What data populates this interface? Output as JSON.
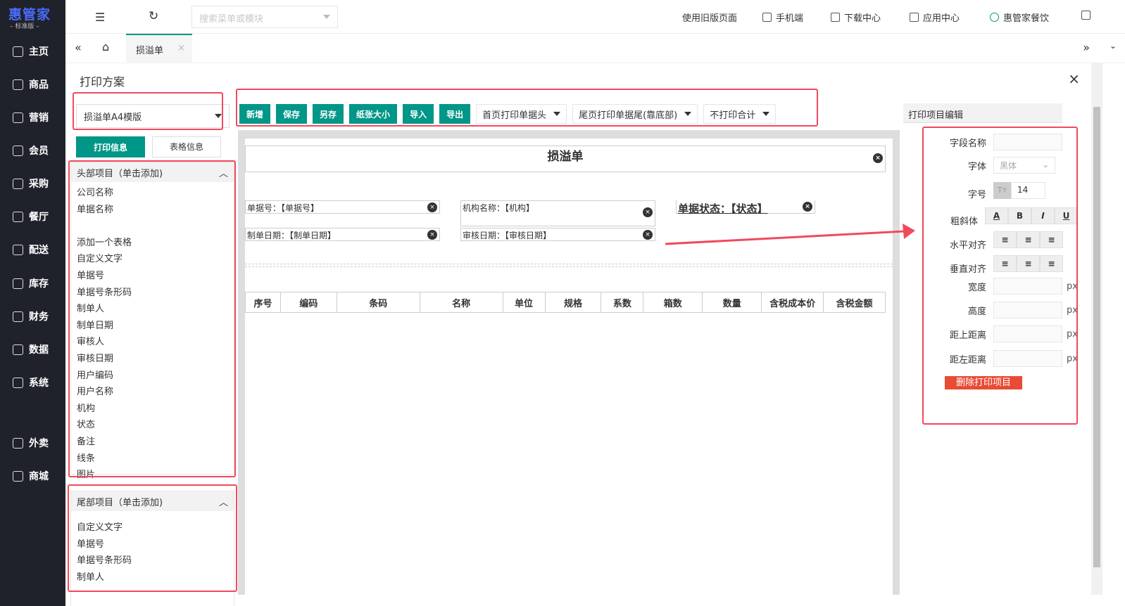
{
  "logo": {
    "name": "惠管家",
    "edition": "标准版"
  },
  "sidebar": {
    "items": [
      {
        "label": "主页",
        "icon": "home-icon"
      },
      {
        "label": "商品",
        "icon": "box-icon"
      },
      {
        "label": "营销",
        "icon": "marketing-icon"
      },
      {
        "label": "会员",
        "icon": "member-icon"
      },
      {
        "label": "采购",
        "icon": "purchase-icon"
      },
      {
        "label": "餐厅",
        "icon": "restaurant-icon"
      },
      {
        "label": "配送",
        "icon": "delivery-icon"
      },
      {
        "label": "库存",
        "icon": "inventory-icon"
      },
      {
        "label": "财务",
        "icon": "finance-icon"
      },
      {
        "label": "数据",
        "icon": "data-icon"
      },
      {
        "label": "系统",
        "icon": "system-icon"
      },
      {
        "label": "外卖",
        "icon": "takeout-icon"
      },
      {
        "label": "商城",
        "icon": "mall-icon"
      }
    ]
  },
  "topbar": {
    "search_placeholder": "搜索菜单或模块",
    "old_page": "使用旧版页面",
    "mobile": "手机端",
    "download": "下载中心",
    "apps": "应用中心",
    "user": "惠管家餐饮"
  },
  "tabs": {
    "active": "损溢单"
  },
  "panel": {
    "title": "打印方案",
    "template": "损溢单A4模版",
    "tab_print": "打印信息",
    "tab_table": "表格信息",
    "toolbar": [
      "新增",
      "保存",
      "另存",
      "纸张大小",
      "导入",
      "导出"
    ],
    "dropdowns": [
      "首页打印单据头",
      "尾页打印单据尾(靠底部)",
      "不打印合计"
    ],
    "header_list": {
      "title": "头部项目（单击添加)",
      "items": [
        "公司名称",
        "单据名称",
        "",
        "添加一个表格",
        "自定义文字",
        "单据号",
        "单据号条形码",
        "制单人",
        "制单日期",
        "审核人",
        "审核日期",
        "用户编码",
        "用户名称",
        "机构",
        "状态",
        "备注",
        "线条",
        "图片"
      ]
    },
    "footer_list": {
      "title": "尾部项目（单击添加)",
      "items": [
        "自定义文字",
        "单据号",
        "单据号条形码",
        "制单人"
      ]
    }
  },
  "paper": {
    "title": "损溢单",
    "fields": {
      "doc_no": "单据号：【单据号】",
      "org": "机构名称：【机构】",
      "status": "单据状态：【状态】",
      "made_date": "制单日期：【制单日期】",
      "audit_date": "审核日期：【审核日期】"
    },
    "columns": [
      "序号",
      "编码",
      "条码",
      "名称",
      "单位",
      "规格",
      "系数",
      "箱数",
      "数量",
      "含税成本价",
      "含税金额"
    ]
  },
  "editor": {
    "title": "打印项目编辑",
    "field_name": "字段名称",
    "font": "字体",
    "font_value": "黑体",
    "size": "字号",
    "size_value": "14",
    "style": "粗斜体",
    "halign": "水平对齐",
    "valign": "垂直对齐",
    "width": "宽度",
    "height": "高度",
    "top": "距上距离",
    "left": "距左距离",
    "unit": "px",
    "delete": "删除打印项目",
    "style_btns": [
      "A",
      "B",
      "I",
      "U"
    ]
  }
}
